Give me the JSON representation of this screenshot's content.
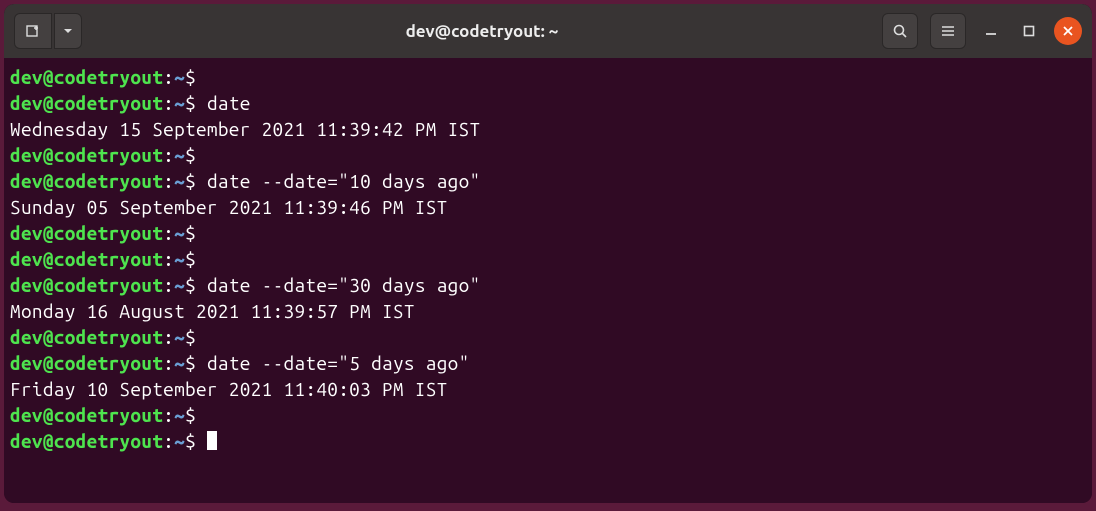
{
  "titlebar": {
    "title": "dev@codetryout: ~"
  },
  "prompt": {
    "user_host": "dev@codetryout",
    "sep": ":",
    "path": "~",
    "symbol": "$"
  },
  "lines": [
    {
      "type": "prompt",
      "cmd": ""
    },
    {
      "type": "prompt",
      "cmd": "date"
    },
    {
      "type": "output",
      "text": "Wednesday 15 September 2021 11:39:42 PM IST"
    },
    {
      "type": "prompt",
      "cmd": ""
    },
    {
      "type": "prompt",
      "cmd": "date --date=\"10 days ago\""
    },
    {
      "type": "output",
      "text": "Sunday 05 September 2021 11:39:46 PM IST"
    },
    {
      "type": "prompt",
      "cmd": ""
    },
    {
      "type": "prompt",
      "cmd": ""
    },
    {
      "type": "prompt",
      "cmd": "date --date=\"30 days ago\""
    },
    {
      "type": "output",
      "text": "Monday 16 August 2021 11:39:57 PM IST"
    },
    {
      "type": "prompt",
      "cmd": ""
    },
    {
      "type": "prompt",
      "cmd": "date --date=\"5 days ago\""
    },
    {
      "type": "output",
      "text": "Friday 10 September 2021 11:40:03 PM IST"
    },
    {
      "type": "prompt",
      "cmd": ""
    },
    {
      "type": "prompt",
      "cmd": "",
      "cursor": true
    }
  ]
}
